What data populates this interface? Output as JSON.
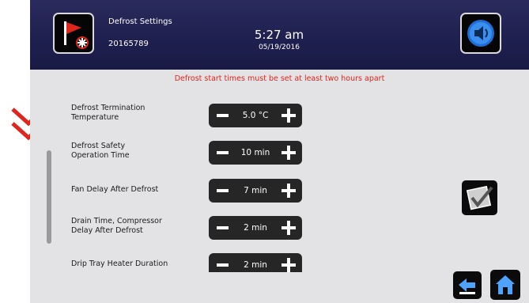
{
  "header": {
    "title": "Defrost Settings",
    "id": "20165789",
    "time": "5:27 am",
    "date": "05/19/2016"
  },
  "warning": "Defrost start times must be set at least two hours apart",
  "settings": [
    {
      "label_line1": "Defrost Termination",
      "label_line2": "Temperature",
      "value": "5.0 °C"
    },
    {
      "label_line1": "Defrost Safety",
      "label_line2": "Operation Time",
      "value": "10 min"
    },
    {
      "label_line1": "Fan Delay After Defrost",
      "label_line2": "",
      "value": "7 min"
    },
    {
      "label_line1": "Drain Time, Compressor",
      "label_line2": "Delay After Defrost",
      "value": "2 min"
    },
    {
      "label_line1": "Drip Tray Heater Duration",
      "label_line2": "",
      "value": "2 min"
    }
  ],
  "icons": {
    "defrost": "red-flag-snowflake-icon",
    "sound": "speaker-icon",
    "confirm": "checkmark-icon",
    "back": "back-arrow-icon",
    "home": "home-icon",
    "scroll": "double-chevron-down-icon"
  },
  "colors": {
    "header_bg": "#1f2050",
    "warning": "#e0261c",
    "stepper_bg": "#262626",
    "chevron": "#e0261c"
  }
}
